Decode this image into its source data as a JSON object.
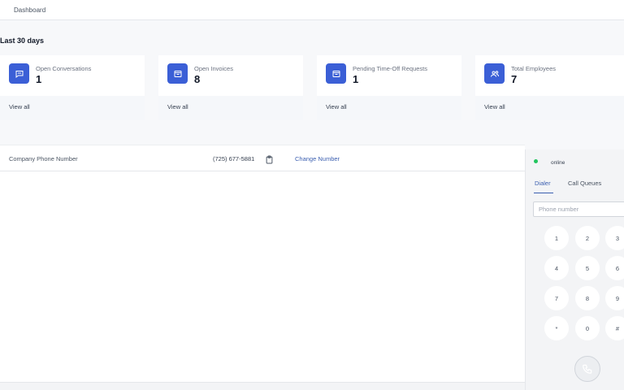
{
  "header": {
    "breadcrumb": "Dashboard"
  },
  "stats": {
    "period_title": "Last 30 days",
    "cards": [
      {
        "label": "Open Conversations",
        "value": "1",
        "link": "View all",
        "icon": "chat-icon"
      },
      {
        "label": "Open Invoices",
        "value": "8",
        "link": "View all",
        "icon": "invoice-icon"
      },
      {
        "label": "Pending Time-Off Requests",
        "value": "1",
        "link": "View all",
        "icon": "time-off-icon"
      },
      {
        "label": "Total Employees",
        "value": "7",
        "link": "View all",
        "icon": "users-icon"
      }
    ]
  },
  "phone": {
    "label": "Company Phone Number",
    "number": "(725) 677-5881",
    "copy_icon": "clipboard-icon",
    "change_label": "Change Number"
  },
  "dialer": {
    "status": "online",
    "tabs": [
      "Dialer",
      "Call Queues"
    ],
    "active_tab": "Dialer",
    "placeholder": "Phone number",
    "keys": [
      "1",
      "2",
      "3",
      "4",
      "5",
      "6",
      "7",
      "8",
      "9",
      "*",
      "0",
      "#"
    ],
    "call_icon": "phone-icon"
  },
  "colors": {
    "accent": "#3b5fd6",
    "link": "#3b5fb0",
    "online": "#22c55e"
  }
}
